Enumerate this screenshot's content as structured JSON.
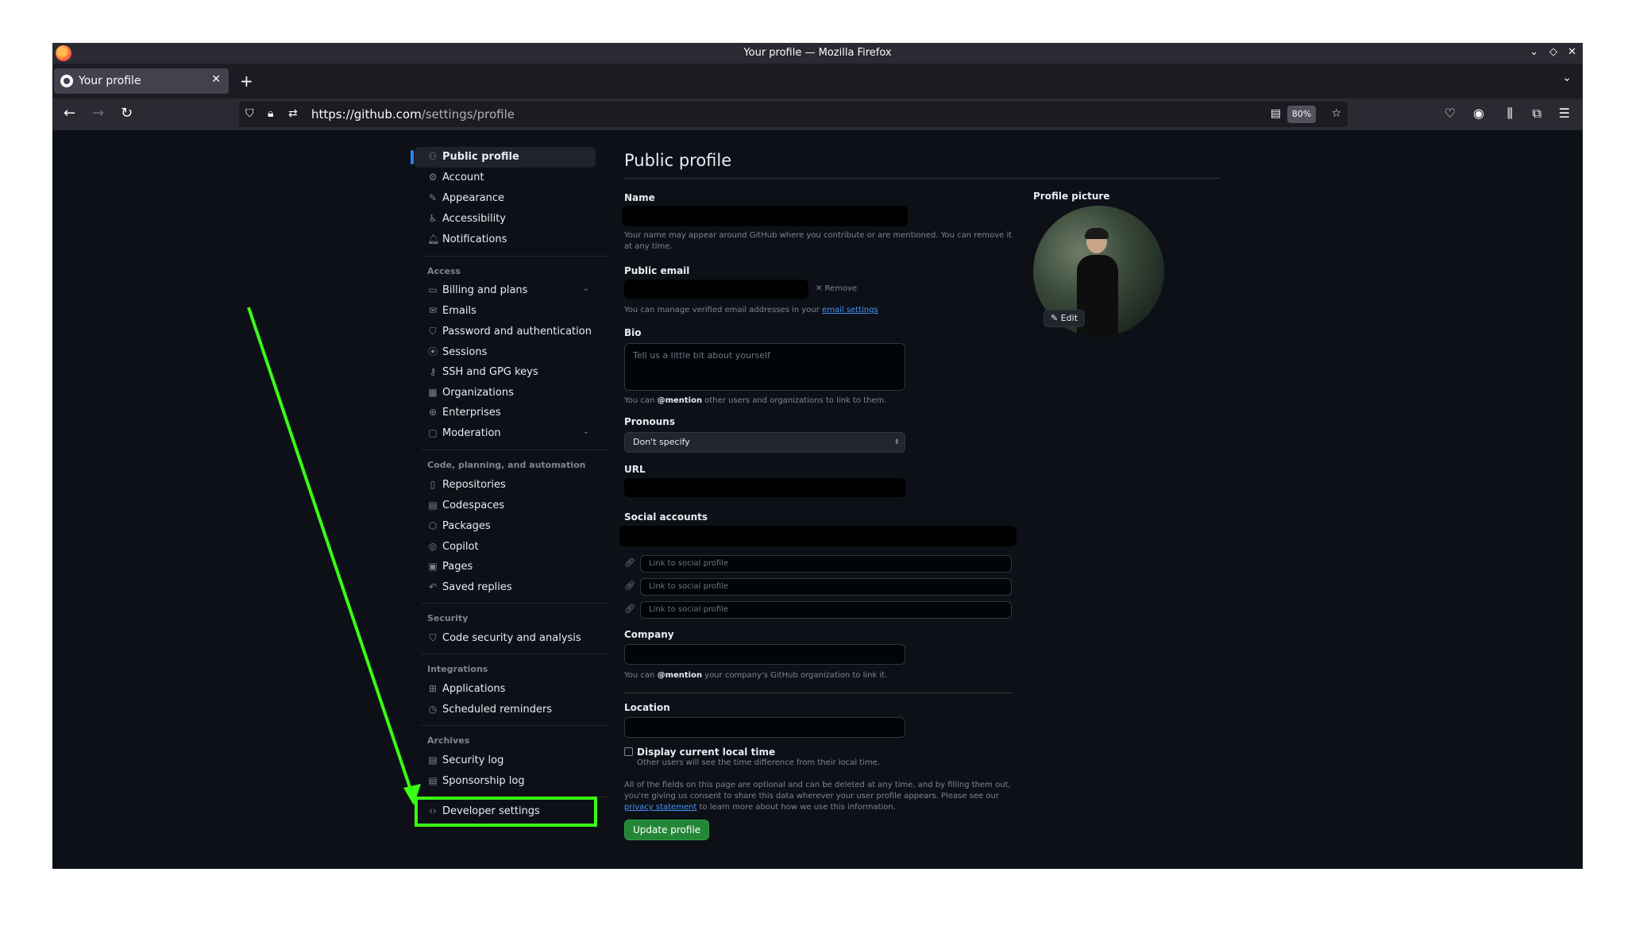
{
  "browser": {
    "window_title": "Your profile — Mozilla Firefox",
    "tab_title": "Your profile",
    "url_host": "https://github.com",
    "url_path": "/settings/profile",
    "zoom": "80%"
  },
  "sidebar": {
    "top_items": [
      {
        "label": "Public profile",
        "icon": "person-icon",
        "active": true
      },
      {
        "label": "Account",
        "icon": "gear-icon"
      },
      {
        "label": "Appearance",
        "icon": "paintbrush-icon"
      },
      {
        "label": "Accessibility",
        "icon": "accessibility-icon"
      },
      {
        "label": "Notifications",
        "icon": "bell-icon"
      }
    ],
    "access_heading": "Access",
    "access_items": [
      {
        "label": "Billing and plans",
        "icon": "credit-card-icon",
        "expandable": true
      },
      {
        "label": "Emails",
        "icon": "mail-icon"
      },
      {
        "label": "Password and authentication",
        "icon": "shield-lock-icon"
      },
      {
        "label": "Sessions",
        "icon": "broadcast-icon"
      },
      {
        "label": "SSH and GPG keys",
        "icon": "key-icon"
      },
      {
        "label": "Organizations",
        "icon": "organization-icon"
      },
      {
        "label": "Enterprises",
        "icon": "globe-icon"
      },
      {
        "label": "Moderation",
        "icon": "report-icon",
        "expandable": true
      }
    ],
    "code_heading": "Code, planning, and automation",
    "code_items": [
      {
        "label": "Repositories",
        "icon": "repo-icon"
      },
      {
        "label": "Codespaces",
        "icon": "codespaces-icon"
      },
      {
        "label": "Packages",
        "icon": "package-icon"
      },
      {
        "label": "Copilot",
        "icon": "copilot-icon"
      },
      {
        "label": "Pages",
        "icon": "browser-icon"
      },
      {
        "label": "Saved replies",
        "icon": "reply-icon"
      }
    ],
    "security_heading": "Security",
    "security_items": [
      {
        "label": "Code security and analysis",
        "icon": "shield-icon"
      }
    ],
    "integrations_heading": "Integrations",
    "integrations_items": [
      {
        "label": "Applications",
        "icon": "apps-icon"
      },
      {
        "label": "Scheduled reminders",
        "icon": "clock-icon"
      }
    ],
    "archives_heading": "Archives",
    "archives_items": [
      {
        "label": "Security log",
        "icon": "log-icon"
      },
      {
        "label": "Sponsorship log",
        "icon": "log-icon"
      }
    ],
    "developer_settings": {
      "label": "Developer settings",
      "icon": "code-icon"
    }
  },
  "main": {
    "title": "Public profile",
    "name_label": "Name",
    "name_note": "Your name may appear around GitHub where you contribute or are mentioned. You can remove it at any time.",
    "email_label": "Public email",
    "email_remove": "Remove",
    "email_note_prefix": "You can manage verified email addresses in your ",
    "email_note_link": "email settings",
    "bio_label": "Bio",
    "bio_placeholder": "Tell us a little bit about yourself",
    "bio_note_prefix": "You can ",
    "bio_note_mention": "@mention",
    "bio_note_suffix": " other users and organizations to link to them.",
    "pronouns_label": "Pronouns",
    "pronouns_value": "Don't specify",
    "url_label": "URL",
    "social_label": "Social accounts",
    "social_placeholder": "Link to social profile",
    "company_label": "Company",
    "company_note_prefix": "You can ",
    "company_note_mention": "@mention",
    "company_note_suffix": " your company's GitHub organization to link it.",
    "location_label": "Location",
    "localtime_label": "Display current local time",
    "localtime_note": "Other users will see the time difference from their local time.",
    "disclaimer_prefix": "All of the fields on this page are optional and can be deleted at any time, and by filling them out, you're giving us consent to share this data wherever your user profile appears. Please see our ",
    "disclaimer_link": "privacy statement",
    "disclaimer_suffix": " to learn more about how we use this information.",
    "update_button": "Update profile",
    "picture_label": "Profile picture",
    "picture_edit": "Edit"
  },
  "annotation": {
    "color": "#39ff14"
  }
}
